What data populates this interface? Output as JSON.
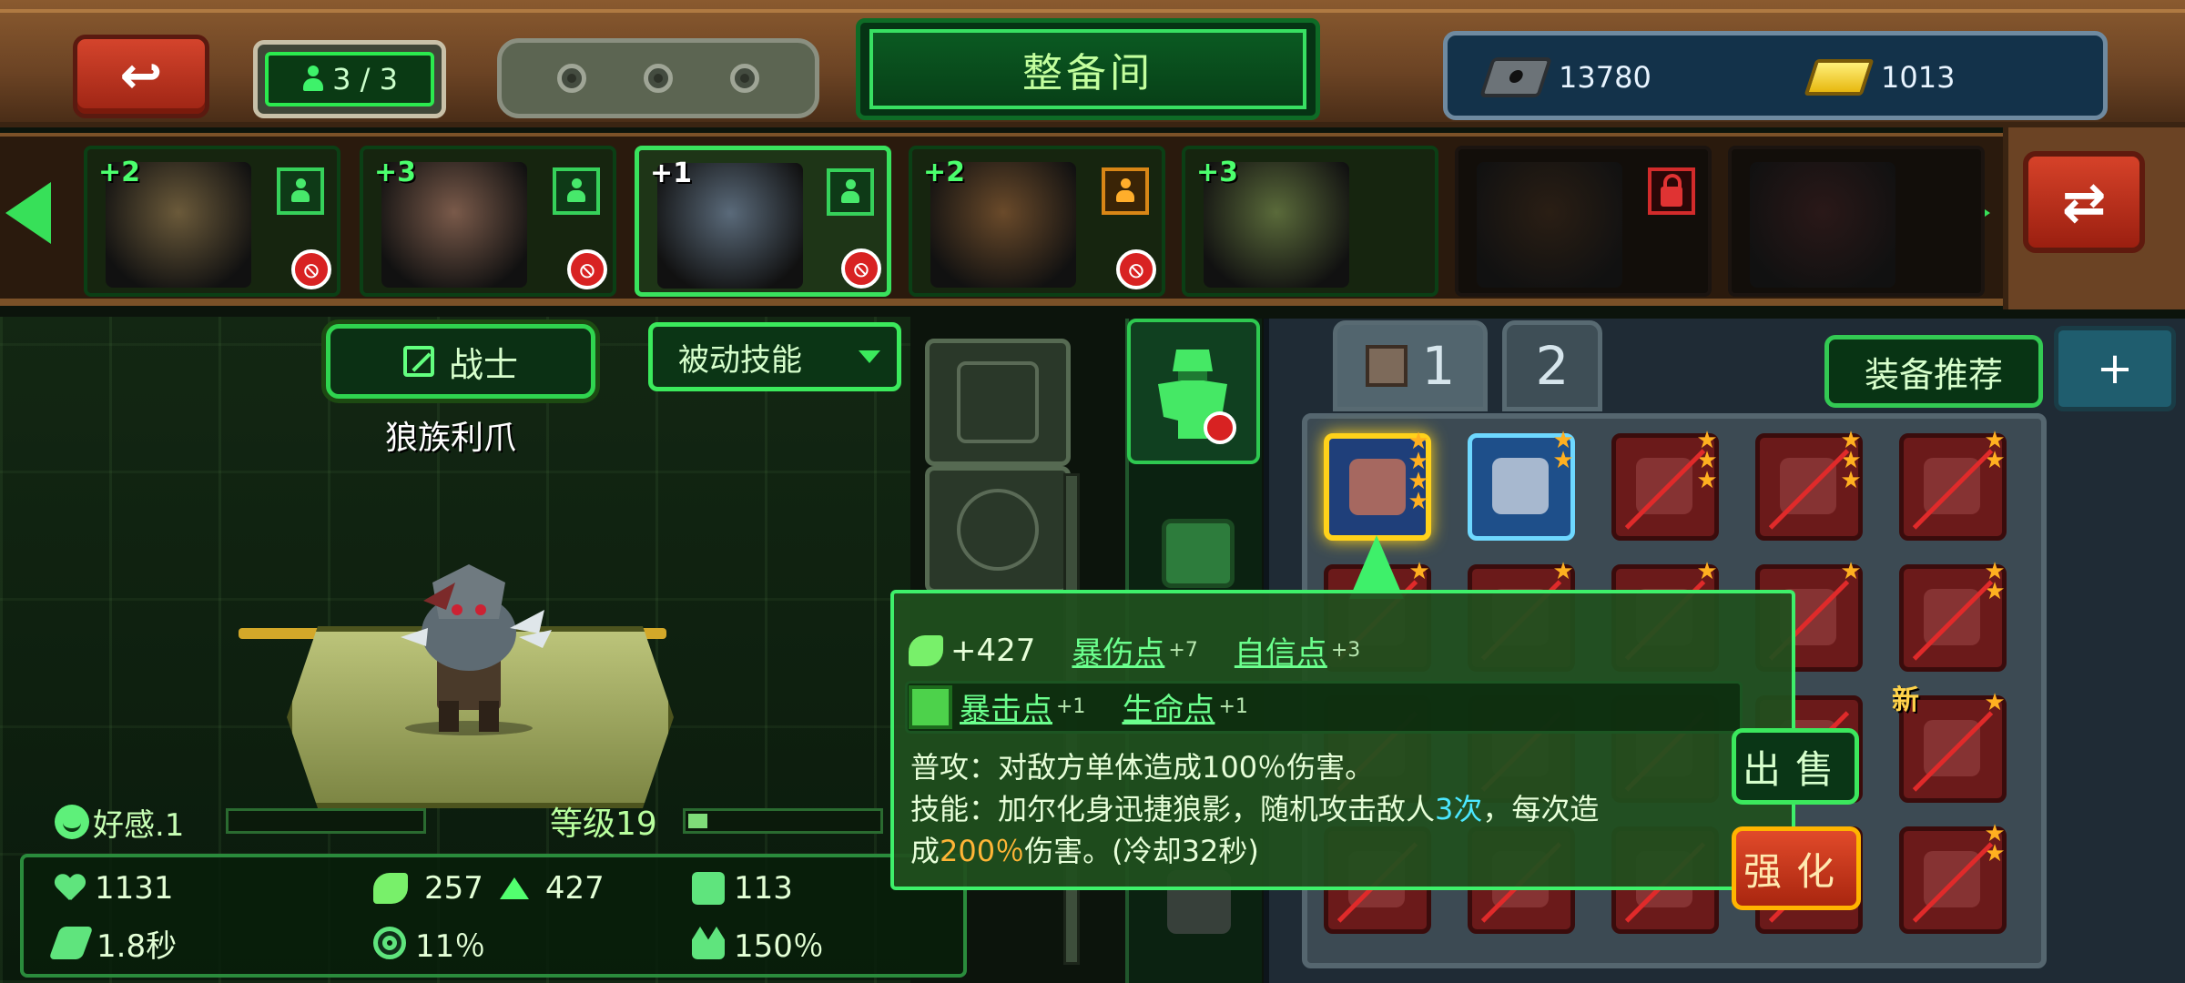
{
  "header": {
    "back_icon": "↩",
    "squad_count": "3 / 3",
    "title": "整备间",
    "currency": [
      {
        "icon": "chip-icon",
        "value": "13780"
      },
      {
        "icon": "gold-bar-icon",
        "value": "1013"
      }
    ],
    "swap_icon": "⇄"
  },
  "heroes": [
    {
      "plus": "+2",
      "badge": "person",
      "warning": "⦸",
      "state": "normal",
      "color": "#6b5a3a"
    },
    {
      "plus": "+3",
      "badge": "person",
      "warning": "⦸",
      "state": "normal",
      "color": "#7a5a4a"
    },
    {
      "plus": "+1",
      "badge": "person",
      "warning": "⦸",
      "state": "selected",
      "color": "#5a6a7a"
    },
    {
      "plus": "+2",
      "badge": "person-orange",
      "warning": "⦸",
      "state": "normal",
      "color": "#6a4a2a"
    },
    {
      "plus": "+3",
      "badge": "",
      "warning": "",
      "state": "normal",
      "color": "#5a6a3a"
    },
    {
      "plus": "",
      "badge": "lock",
      "warning": "",
      "state": "locked",
      "color": "#2a1e14"
    },
    {
      "plus": "",
      "badge": "",
      "warning": "",
      "state": "locked",
      "color": "#2a1818"
    }
  ],
  "character": {
    "class_label": "战士",
    "skill_dropdown": "被动技能",
    "skill_name": "狼族利爪",
    "affinity": "好感.1",
    "level": "等级19",
    "level_progress": 0.1
  },
  "stats": [
    {
      "icon": "heart-icon",
      "value": "1131"
    },
    {
      "icon": "muscle-icon",
      "value": "257",
      "bonus": "427"
    },
    {
      "icon": "armor-icon",
      "value": "113"
    },
    {
      "icon": "speed-icon",
      "value": "1.8秒"
    },
    {
      "icon": "target-icon",
      "value": "11％"
    },
    {
      "icon": "crown-icon",
      "value": "150％"
    }
  ],
  "inventory": {
    "tabs": [
      "1",
      "2"
    ],
    "recommend_label": "装备推荐",
    "add_label": "+",
    "new_label": "新",
    "sell_label": "出售",
    "upgrade_label": "强化"
  },
  "tooltip": {
    "attack_value": "+427",
    "row1": [
      {
        "label": "暴伤点",
        "bonus": "+7"
      },
      {
        "label": "自信点",
        "bonus": "+3"
      }
    ],
    "row2": [
      {
        "label": "暴击点",
        "bonus": "+1"
      },
      {
        "label": "生命点",
        "bonus": "+1"
      }
    ],
    "normal_attack": "普攻：对敌方单体造成100％伤害。",
    "skill_prefix": "技能：加尔化身迅捷狼影，随机攻击敌人",
    "skill_hits": "3次",
    "skill_mid": "，每次造",
    "skill_line2_prefix": "成",
    "skill_damage": "200％",
    "skill_suffix": "伤害。(冷却32秒)"
  },
  "colors": {
    "accent_green": "#3ef06a",
    "panel_brown": "#6b4324",
    "danger_red": "#d82222",
    "gold": "#ffd21a"
  }
}
